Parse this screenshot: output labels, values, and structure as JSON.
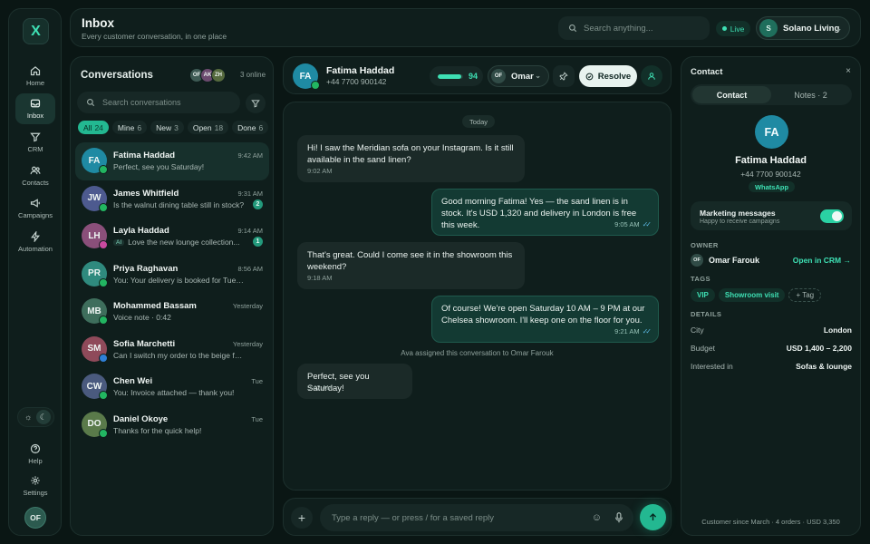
{
  "rail": {
    "logo": "X",
    "nav": [
      {
        "label": "Home",
        "icon": "home-icon"
      },
      {
        "label": "Inbox",
        "icon": "inbox-icon"
      },
      {
        "label": "CRM",
        "icon": "funnel-icon"
      },
      {
        "label": "Contacts",
        "icon": "users-icon"
      },
      {
        "label": "Campaigns",
        "icon": "megaphone-icon"
      },
      {
        "label": "Automation",
        "icon": "bolt-icon"
      }
    ],
    "bottom": [
      {
        "label": "Help",
        "icon": "help-icon"
      },
      {
        "label": "Settings",
        "icon": "gear-icon"
      }
    ],
    "theme": {
      "light": "☼",
      "dark": "☾"
    },
    "user_initials": "OF"
  },
  "topbar": {
    "title": "Inbox",
    "subtitle": "Every customer conversation, in one place",
    "search_placeholder": "Search anything...",
    "live_label": "Live",
    "workspace_initial": "S",
    "workspace_name": "Solano Living"
  },
  "conversations": {
    "title": "Conversations",
    "online_avatars": [
      {
        "initials": "OF",
        "color": "#3e5a54"
      },
      {
        "initials": "AK",
        "color": "#6b4a6e"
      },
      {
        "initials": "ZH",
        "color": "#566a3e"
      }
    ],
    "online_text": "3 online",
    "search_placeholder": "Search conversations",
    "filters": [
      {
        "label": "All",
        "count": "24"
      },
      {
        "label": "Mine",
        "count": "6"
      },
      {
        "label": "New",
        "count": "3"
      },
      {
        "label": "Open",
        "count": "18"
      },
      {
        "label": "Done",
        "count": "6"
      }
    ],
    "items": [
      {
        "initials": "FA",
        "color": "#1f8aa3",
        "channel": "#22b561",
        "name": "Fatima Haddad",
        "time": "9:42 AM",
        "preview": "Perfect, see you Saturday!",
        "unread": "",
        "ai": ""
      },
      {
        "initials": "JW",
        "color": "#4d5a8f",
        "channel": "#22b561",
        "name": "James Whitfield",
        "time": "9:31 AM",
        "preview": "Is the walnut dining table still in stock?",
        "unread": "2",
        "ai": ""
      },
      {
        "initials": "LH",
        "color": "#8a4f7a",
        "channel": "#c94aa0",
        "name": "Layla Haddad",
        "time": "9:14 AM",
        "preview": "Love the new lounge collection...",
        "unread": "1",
        "ai": "AI"
      },
      {
        "initials": "PR",
        "color": "#2f8a7e",
        "channel": "#22b561",
        "name": "Priya Raghavan",
        "time": "8:56 AM",
        "preview": "You: Your delivery is booked for Tuesday",
        "unread": "",
        "ai": ""
      },
      {
        "initials": "MB",
        "color": "#3e6e5c",
        "channel": "#22b561",
        "name": "Mohammed Bassam",
        "time": "Yesterday",
        "preview": "Voice note · 0:42",
        "unread": "",
        "ai": ""
      },
      {
        "initials": "SM",
        "color": "#8f4a5a",
        "channel": "#2f7fd6",
        "name": "Sofia Marchetti",
        "time": "Yesterday",
        "preview": "Can I switch my order to the beige fabric?",
        "unread": "",
        "ai": ""
      },
      {
        "initials": "CW",
        "color": "#4a5a7e",
        "channel": "#22b561",
        "name": "Chen Wei",
        "time": "Tue",
        "preview": "You: Invoice attached — thank you!",
        "unread": "",
        "ai": ""
      },
      {
        "initials": "DO",
        "color": "#5a7a4a",
        "channel": "#22b561",
        "name": "Daniel Okoye",
        "time": "Tue",
        "preview": "Thanks for the quick help!",
        "unread": "",
        "ai": ""
      }
    ]
  },
  "chat": {
    "contact_initials": "FA",
    "contact_name": "Fatima Haddad",
    "contact_phone": "+44 7700 900142",
    "score": "94",
    "score_fraction": 0.94,
    "assignee_initials": "OF",
    "assignee_name": "Omar",
    "resolve_label": "Resolve",
    "day_label": "Today",
    "messages": [
      {
        "dir": "in",
        "text": "Hi! I saw the Meridian sofa on your Instagram. Is it still available in the sand linen?",
        "time": "9:02 AM"
      },
      {
        "dir": "out",
        "text": "Good morning Fatima! Yes — the sand linen is in stock. It's USD 1,320 and delivery in London is free this week.",
        "time": "9:05 AM"
      },
      {
        "dir": "in",
        "text": "That's great. Could I come see it in the showroom this weekend?",
        "time": "9:18 AM"
      },
      {
        "dir": "out",
        "text": "Of course! We're open Saturday 10 AM – 9 PM at our Chelsea showroom. I'll keep one on the floor for you.",
        "time": "9:21 AM"
      },
      {
        "dir": "in",
        "text": "Perfect, see you Saturday!",
        "time": "9:42 AM"
      }
    ],
    "system_message": "Ava assigned this conversation to Omar Farouk",
    "reply_placeholder": "Type a reply — or press / for a saved reply"
  },
  "contact": {
    "title": "Contact",
    "close": "×",
    "tabs": [
      {
        "label": "Contact"
      },
      {
        "label": "Notes · 2"
      }
    ],
    "initials": "FA",
    "name": "Fatima Haddad",
    "phone": "+44 7700 900142",
    "channel": "WhatsApp",
    "marketing_title": "Marketing messages",
    "marketing_sub": "Happy to receive campaigns",
    "owner_heading": "OWNER",
    "owner_initials": "OF",
    "owner_name": "Omar Farouk",
    "owner_link": "Open in CRM →",
    "tags_heading": "TAGS",
    "tags": [
      "VIP",
      "Showroom visit"
    ],
    "add_tag": "+ Tag",
    "details_heading": "DETAILS",
    "details": [
      {
        "k": "City",
        "v": "London"
      },
      {
        "k": "Budget",
        "v": "USD 1,400 – 2,200"
      },
      {
        "k": "Interested in",
        "v": "Sofas & lounge"
      }
    ],
    "footer": "Customer since March · 4 orders · USD 3,350"
  }
}
